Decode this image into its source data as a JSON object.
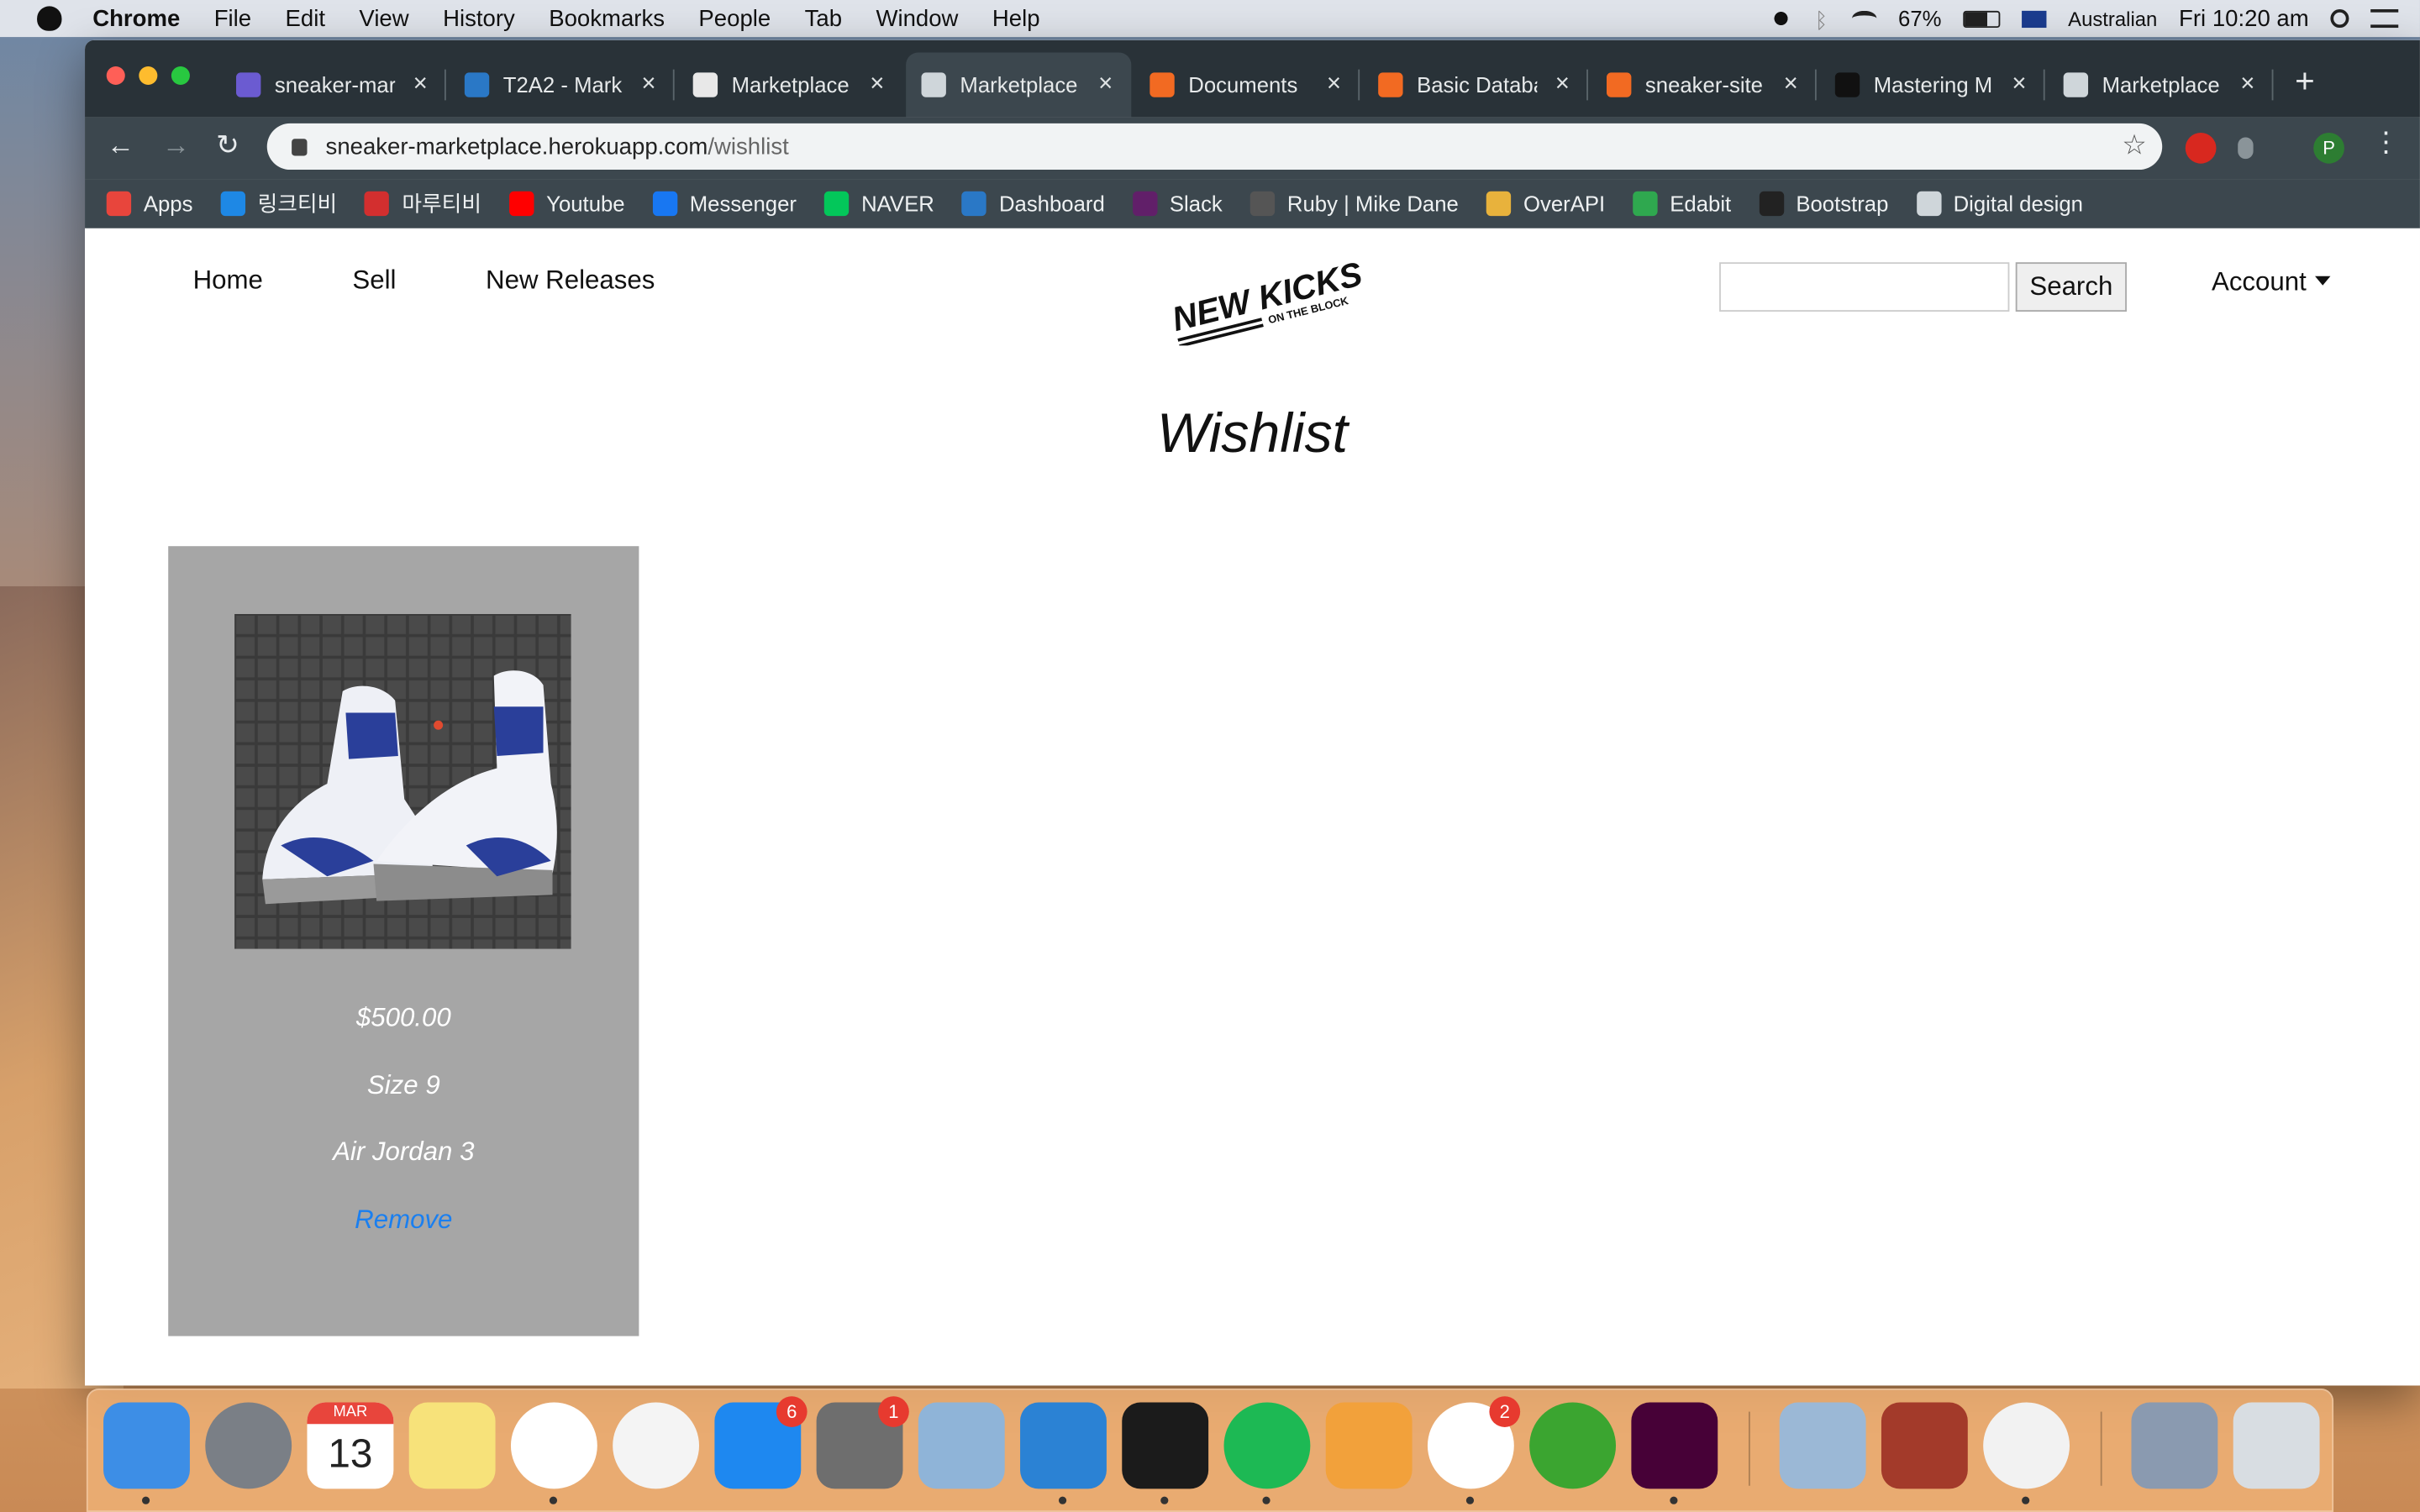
{
  "menubar": {
    "app": "Chrome",
    "items": [
      "File",
      "Edit",
      "View",
      "History",
      "Bookmarks",
      "People",
      "Tab",
      "Window",
      "Help"
    ],
    "battery": "67%",
    "input_source": "Australian",
    "clock": "Fri 10:20 am"
  },
  "browser": {
    "tabs": [
      {
        "title": "sneaker-mar",
        "color": "#6b5bd1"
      },
      {
        "title": "T2A2 - Mark",
        "color": "#2a78c6"
      },
      {
        "title": "Marketplace",
        "color": "#e8e8e8"
      },
      {
        "title": "Marketplace",
        "color": "#cfd6da"
      },
      {
        "title": "Documents",
        "color": "#f26a22"
      },
      {
        "title": "Basic Databa",
        "color": "#f26a22"
      },
      {
        "title": "sneaker-site",
        "color": "#f26a22"
      },
      {
        "title": "Mastering M",
        "color": "#111111"
      },
      {
        "title": "Marketplace",
        "color": "#cfd6da"
      }
    ],
    "active_tab": 3,
    "url_host": "sneaker-marketplace.herokuapp.com",
    "url_path": "/wishlist",
    "profile_initial": "P",
    "bookmarks": [
      {
        "label": "Apps",
        "color": "#e8453c"
      },
      {
        "label": "링크티비",
        "color": "#1e88e5"
      },
      {
        "label": "마루티비",
        "color": "#d32f2f"
      },
      {
        "label": "Youtube",
        "color": "#ff0000"
      },
      {
        "label": "Messenger",
        "color": "#1877f2"
      },
      {
        "label": "NAVER",
        "color": "#03c75a"
      },
      {
        "label": "Dashboard",
        "color": "#2a78c6"
      },
      {
        "label": "Slack",
        "color": "#611f69"
      },
      {
        "label": "Ruby | Mike Dane",
        "color": "#555555"
      },
      {
        "label": "OverAPI",
        "color": "#e8b23c"
      },
      {
        "label": "Edabit",
        "color": "#2fa84f"
      },
      {
        "label": "Bootstrap",
        "color": "#222222"
      },
      {
        "label": "Digital design",
        "color": "#cfd6da"
      }
    ]
  },
  "site": {
    "nav": [
      "Home",
      "Sell",
      "New Releases"
    ],
    "logo_main": "NEW KICKS",
    "logo_sub": "ON THE BLOCK",
    "search_value": "",
    "search_button": "Search",
    "account": "Account",
    "page_title": "Wishlist",
    "items": [
      {
        "price": "$500.00",
        "size": "Size 9",
        "name": "Air Jordan 3",
        "remove": "Remove"
      }
    ]
  },
  "dock": {
    "calendar_month": "MAR",
    "calendar_day": "13",
    "badges": {
      "app_store": "6",
      "system_prefs": "1",
      "slack": "2"
    },
    "apps": [
      "finder-icon",
      "launchpad-icon",
      "calendar-icon",
      "notes-icon",
      "chrome-icon",
      "photos-icon",
      "app-store-icon",
      "system-preferences-icon",
      "preview-icon",
      "vscode-icon",
      "terminal-icon",
      "spotify-icon",
      "pages-icon",
      "slack-icon",
      "utorrent-icon",
      "adobe-xd-icon",
      "mail-icon",
      "dictionary-icon",
      "sequel-pro-icon",
      "downloads-icon",
      "trash-icon"
    ]
  }
}
